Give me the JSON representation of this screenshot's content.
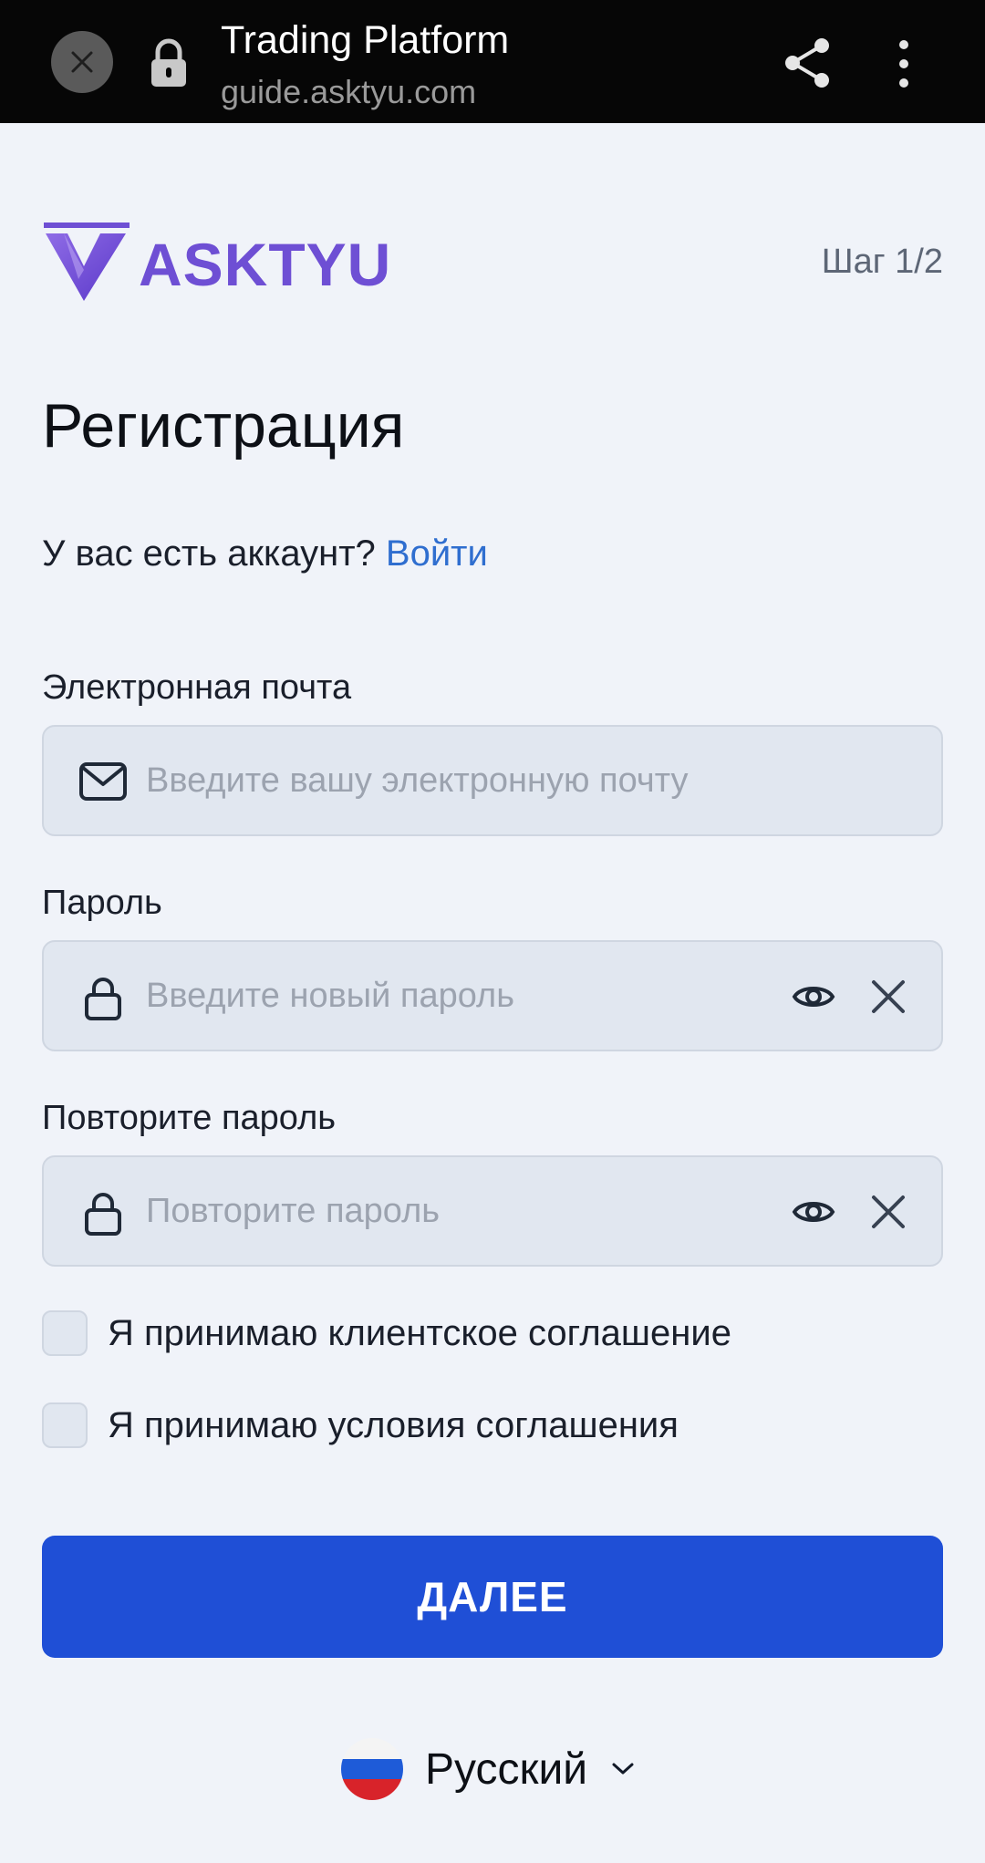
{
  "browser": {
    "title": "Trading Platform",
    "url": "guide.asktyu.com",
    "icons": {
      "close": "close-icon",
      "lock": "lock-icon",
      "share": "share-icon",
      "more": "more-vertical-icon"
    }
  },
  "header": {
    "logo_text": "ASKTYU",
    "logo_icon": "asktyu-logo-icon",
    "step": "Шаг 1/2"
  },
  "page": {
    "title": "Регистрация",
    "have_account": "У вас есть аккаунт?",
    "login_link": "Войти"
  },
  "form": {
    "email": {
      "label": "Электронная почта",
      "placeholder": "Введите вашу электронную почту",
      "value": "",
      "icon": "mail-icon"
    },
    "password": {
      "label": "Пароль",
      "placeholder": "Введите новый пароль",
      "value": "",
      "icon": "lock-icon"
    },
    "repeat_password": {
      "label": "Повторите пароль",
      "placeholder": "Повторите пароль",
      "value": "",
      "icon": "lock-icon"
    },
    "checkboxes": [
      {
        "label": "Я принимаю клиентское соглашение",
        "checked": false
      },
      {
        "label": "Я принимаю условия соглашения",
        "checked": false
      }
    ],
    "submit_label": "ДАЛЕЕ"
  },
  "language": {
    "selected": "Русский",
    "flag": "russia-flag-icon"
  },
  "colors": {
    "brand": "#6e4fd4",
    "primary_button": "#1f4fd6",
    "link": "#2f6ecf",
    "background": "#f0f3f9",
    "input_bg": "#e1e7f0"
  }
}
